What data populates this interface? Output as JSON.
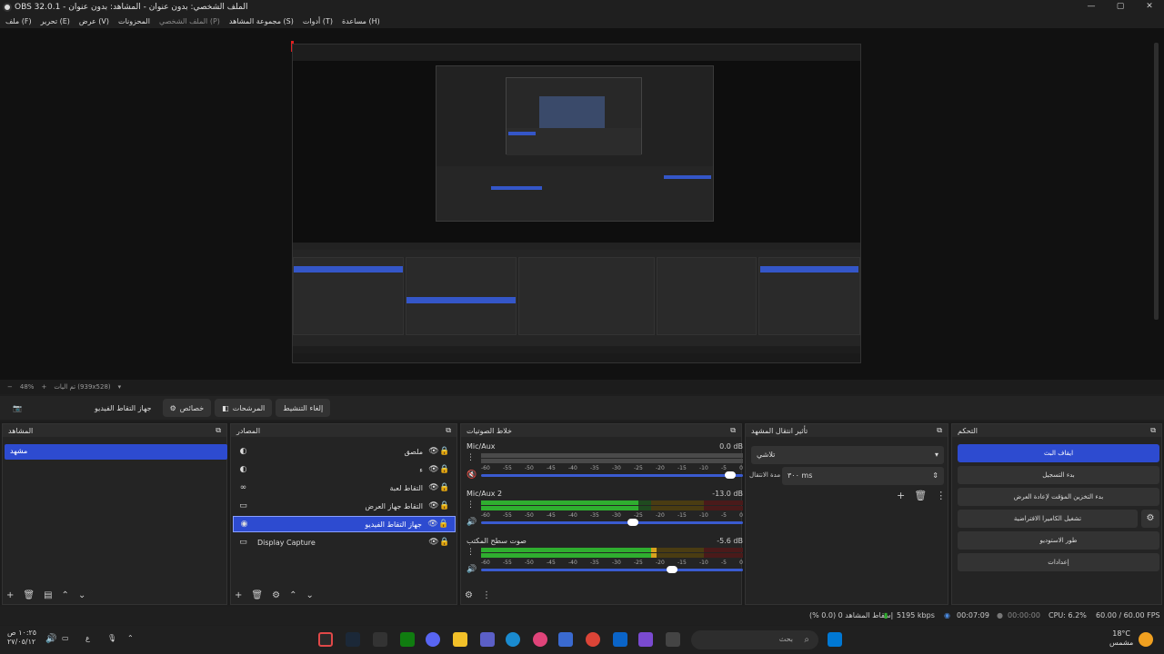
{
  "window": {
    "title": "OBS 32.0.1 - الملف الشخصي: بدون عنوان - المشاهد: بدون عنوان",
    "controls": [
      "—",
      "▢",
      "✕"
    ]
  },
  "menu": {
    "items": [
      "ملف (F)",
      "تحرير (E)",
      "عرض (V)",
      "المحزونات",
      "الملف الشخصي (P)",
      "مجموعة المشاهد (S)",
      "أدوات (T)",
      "مساعدة (H)"
    ]
  },
  "zoom": {
    "percent": "48%",
    "fit_label": "تم اليات (939x528)"
  },
  "toolbar": {
    "source_name": "جهاز التقاط الفيديو",
    "properties": "خصائص",
    "filters": "المرشحات",
    "deactivate": "إلغاء التنشيط"
  },
  "scenes": {
    "title": "المشاهد",
    "items": [
      "مشهد"
    ]
  },
  "sources": {
    "title": "المصادر",
    "items": [
      {
        "name": "ملصق",
        "icon": "palette-icon"
      },
      {
        "name": "ء",
        "icon": "palette-icon"
      },
      {
        "name": "التقاط لعبة",
        "icon": "gamepad-icon"
      },
      {
        "name": "التقاط جهاز العرض",
        "icon": "monitor-icon"
      },
      {
        "name": "جهاز التقاط الفيديو",
        "icon": "camera-icon",
        "selected": true
      },
      {
        "name": "Display Capture",
        "icon": "monitor-icon"
      }
    ]
  },
  "mixer": {
    "title": "خلاط الصوتيات",
    "ticks": [
      "-60",
      "-55",
      "-50",
      "-45",
      "-40",
      "-35",
      "-30",
      "-25",
      "-20",
      "-15",
      "-10",
      "-5",
      "0"
    ],
    "tracks": [
      {
        "name": "Mic/Aux",
        "db": "0.0 dB",
        "level": 0.0,
        "volume": 0.95,
        "muted": true
      },
      {
        "name": "Mic/Aux 2",
        "db": "-13.0 dB",
        "level": 0.6,
        "volume": 0.58,
        "muted": false
      },
      {
        "name": "صوت سطح المكتب",
        "db": "-5.6 dB",
        "level": 0.67,
        "volume": 0.73,
        "muted": false
      }
    ]
  },
  "transitions": {
    "title": "تأثير انتقال المشهد",
    "type": "تلاشي",
    "duration_label": "مدة الانتقال",
    "duration": "٣٠٠ ms"
  },
  "controls": {
    "title": "التحكم",
    "buttons": [
      "ايقاف البث",
      "بدء التسجيل",
      "بدء التخزين المؤقت لإعادة العرض",
      "تشغيل الكاميرا الافتراضية",
      "طور الاستوديو",
      "إعدادات"
    ]
  },
  "status": {
    "dropped": "إسقاط المشاهد 0 (0.0 %)",
    "bitrate": "5195 kbps",
    "stream_time": "00:07:09",
    "rec_time": "00:00:00",
    "cpu": "CPU: 6.2%",
    "fps": "60.00 / 60.00 FPS"
  },
  "taskbar": {
    "search": "بحث",
    "weather_temp": "18°C",
    "weather_text": "مشمس",
    "time": "١٠:٢٥ ص",
    "date": "٢٧/٠٥/١٢",
    "lang": "ع"
  },
  "colors": {
    "accent": "#2d4bd0",
    "green": "#2fae2f",
    "yellow": "#d8a21c",
    "red": "#d23a3a"
  }
}
